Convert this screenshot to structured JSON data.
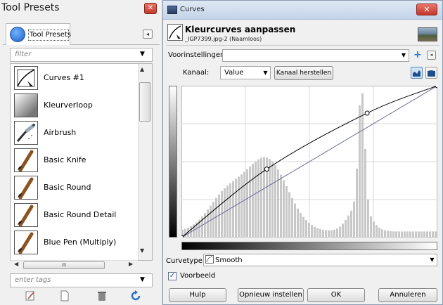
{
  "tool_presets": {
    "title": "Tool Presets",
    "tab_label": "Tool Presets",
    "filter_placeholder": "filter",
    "tags_placeholder": "enter tags",
    "hscroll_grip": "III",
    "items": [
      {
        "label": "Curves #1",
        "icon": "curves-icon"
      },
      {
        "label": "Kleurverloop",
        "icon": "gradient-icon"
      },
      {
        "label": "Airbrush",
        "icon": "airbrush-icon"
      },
      {
        "label": "Basic Knife",
        "icon": "brush-icon"
      },
      {
        "label": "Basic Round",
        "icon": "brush-icon"
      },
      {
        "label": "Basic Round Detail",
        "icon": "brush-icon"
      },
      {
        "label": "Blue Pen (Multiply)",
        "icon": "brush-icon"
      }
    ],
    "bottom_buttons": [
      "edit-preset-icon",
      "new-preset-icon",
      "delete-preset-icon",
      "refresh-presets-icon"
    ]
  },
  "curves": {
    "window_title": "Curves",
    "heading": "Kleurcurves aanpassen",
    "subheading": "_IGP7399.jpg-2 (Naamloos)",
    "presets_label": "Voorinstellingen:",
    "presets_value": "",
    "channel_label": "Kanaal:",
    "channel_value": "Value",
    "reset_channel_label": "Kanaal herstellen",
    "curve_type_label": "Curvetype:",
    "curve_type_value": "Smooth",
    "preview_label": "Voorbeeld",
    "preview_checked": true,
    "buttons": {
      "help": "Hulp",
      "reset": "Opnieuw instellen",
      "ok": "OK",
      "cancel": "Annuleren"
    },
    "colors": {
      "histogram": "#c8c8c8",
      "curve": "#000000",
      "identity_line": "#6a6a9a",
      "grid": "#d8d8d8"
    },
    "curve_points": [
      [
        0,
        0
      ],
      [
        85,
        115
      ],
      [
        185,
        209
      ],
      [
        255,
        255
      ]
    ]
  }
}
